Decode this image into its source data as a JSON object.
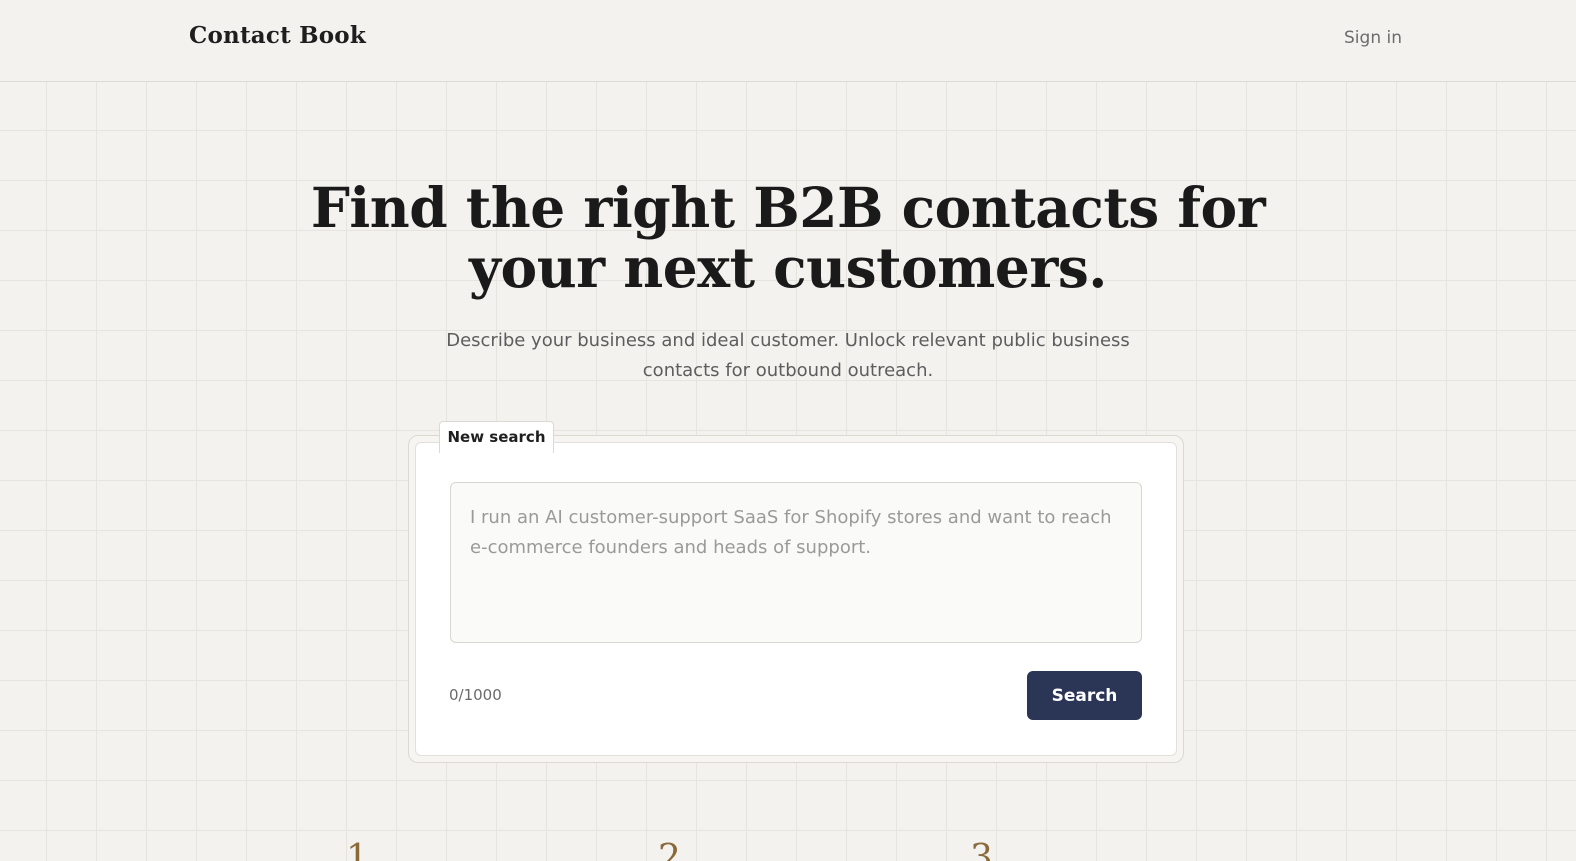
{
  "header": {
    "brand": "Contact Book",
    "sign_in": "Sign in"
  },
  "hero": {
    "title": "Find the right B2B contacts for your next customers.",
    "subtitle": "Describe your business and ideal customer. Unlock relevant public business contacts for outbound outreach."
  },
  "search_card": {
    "tab_label": "New search",
    "placeholder": "I run an AI customer-support SaaS for Shopify stores and want to reach e-commerce founders and heads of support.",
    "value": "",
    "char_count": "0/1000",
    "search_button": "Search"
  },
  "steps": {
    "numbers": [
      "1",
      "2",
      "3"
    ]
  },
  "colors": {
    "background": "#f3f2ee",
    "primary_button": "#2b3656",
    "step_number": "#8a6a3a"
  }
}
